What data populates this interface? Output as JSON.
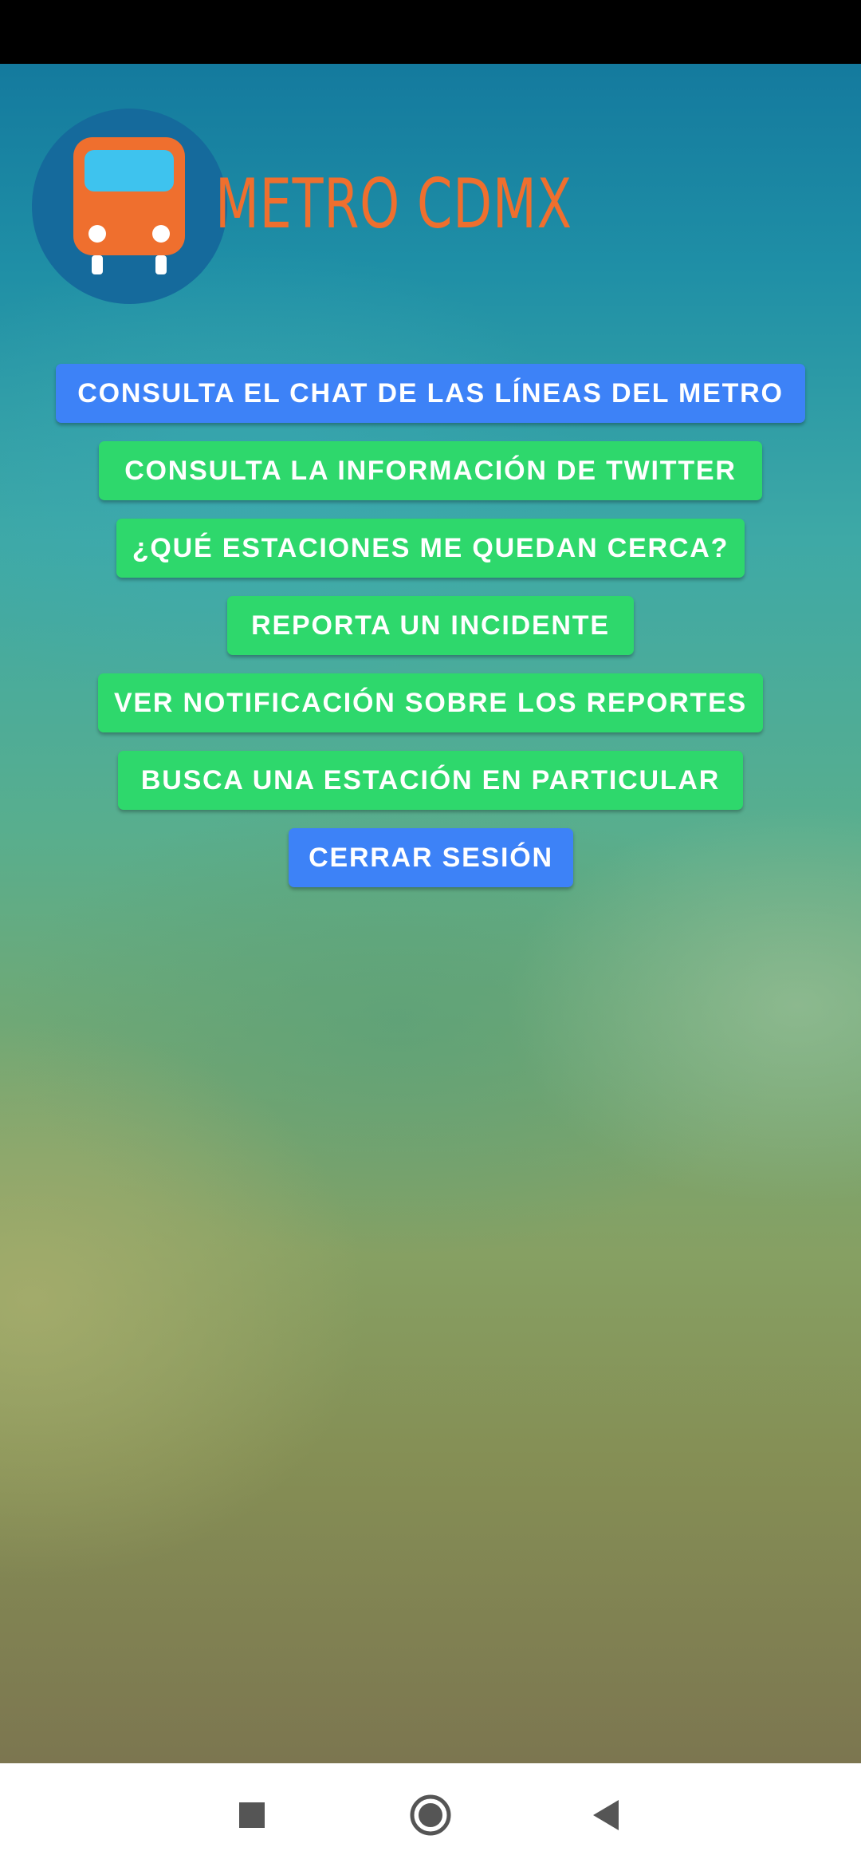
{
  "app": {
    "logo_title": "METRO CDMX"
  },
  "menu": {
    "chat_lines": "CONSULTA EL CHAT DE LAS LÍNEAS DEL METRO",
    "twitter_info": "CONSULTA LA INFORMACIÓN DE TWITTER",
    "nearby_stations": "¿QUÉ ESTACIONES ME QUEDAN CERCA?",
    "report_incident": "REPORTA UN INCIDENTE",
    "report_notifications": "VER NOTIFICACIÓN SOBRE LOS REPORTES",
    "search_station": "BUSCA UNA ESTACIÓN EN PARTICULAR",
    "logout": "CERRAR SESIÓN"
  },
  "colors": {
    "primary_blue": "#3d82f7",
    "action_green": "#2ed86c",
    "logo_orange": "#ef6f2e",
    "logo_circle": "#156a9c"
  },
  "icons": {
    "logo": "bus-icon",
    "nav_recents": "square-icon",
    "nav_home": "circle-icon",
    "nav_back": "triangle-back-icon"
  }
}
